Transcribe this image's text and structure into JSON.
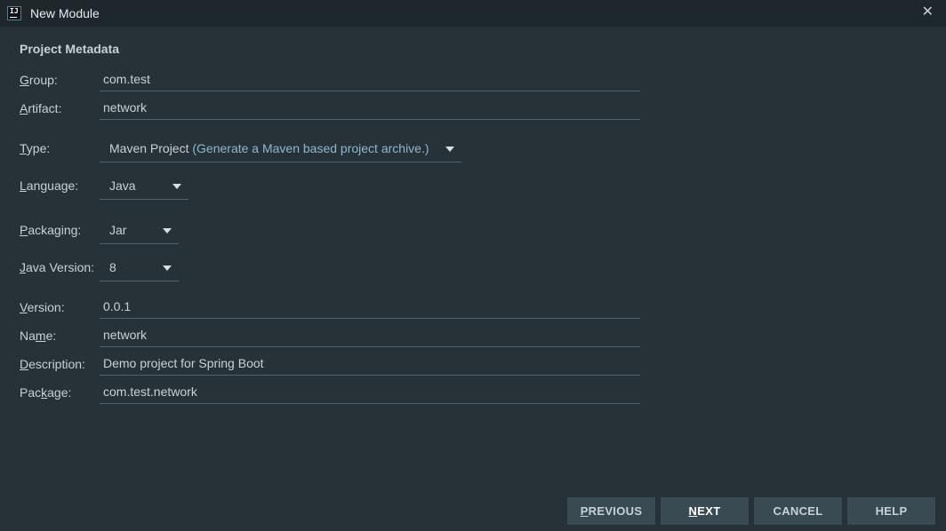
{
  "window": {
    "title": "New Module",
    "close_glyph": "✕",
    "app_icon_text": "IJ"
  },
  "section": {
    "title": "Project Metadata"
  },
  "fields": {
    "group": {
      "label_mn": "G",
      "label_rest": "roup:",
      "value": "com.test"
    },
    "artifact": {
      "label_mn": "A",
      "label_rest": "rtifact:",
      "value": "network"
    },
    "type": {
      "label_mn": "T",
      "label_rest": "ype:",
      "value": "Maven Project",
      "hint": " (Generate a Maven based project archive.)"
    },
    "language": {
      "label_mn": "L",
      "label_rest": "anguage:",
      "value": "Java"
    },
    "packaging": {
      "label_mn": "P",
      "label_rest": "ackaging:",
      "value": "Jar"
    },
    "java_version": {
      "label_mn": "J",
      "label_rest": "ava Version:",
      "value": "8"
    },
    "version": {
      "label_mn": "V",
      "label_rest": "ersion:",
      "value": "0.0.1"
    },
    "name": {
      "label_pre": "Na",
      "label_mn": "m",
      "label_rest": "e:",
      "value": "network"
    },
    "description": {
      "label_mn": "D",
      "label_rest": "escription:",
      "value": "Demo project for Spring Boot"
    },
    "package": {
      "label_pre": "Pac",
      "label_mn": "k",
      "label_rest": "age:",
      "value": "com.test.network"
    }
  },
  "buttons": {
    "previous": {
      "mn": "P",
      "rest": "REVIOUS"
    },
    "next": {
      "mn": "N",
      "rest": "EXT"
    },
    "cancel": "CANCEL",
    "help": "HELP"
  },
  "colors": {
    "background": "#263238",
    "titlebar": "#1e272c",
    "button": "#394a52",
    "hint": "#8fb8cf"
  }
}
